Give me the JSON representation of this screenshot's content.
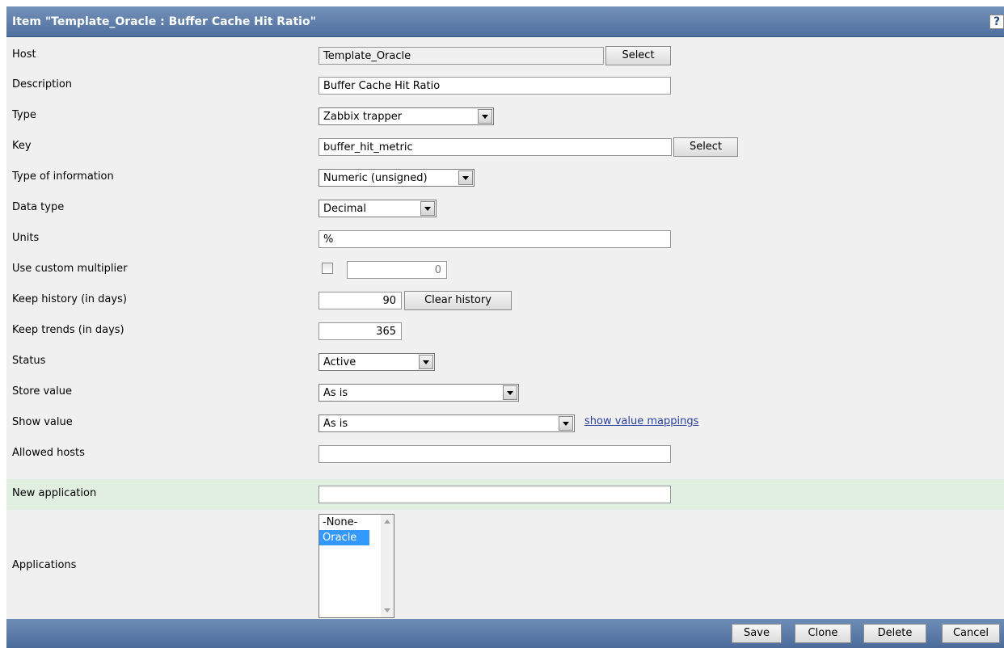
{
  "title": "Item \"Template_Oracle : Buffer Cache Hit Ratio\"",
  "help_label": "?",
  "fields": {
    "host": {
      "label": "Host",
      "value": "Template_Oracle",
      "button": "Select"
    },
    "description": {
      "label": "Description",
      "value": "Buffer Cache Hit Ratio"
    },
    "type": {
      "label": "Type",
      "value": "Zabbix trapper"
    },
    "key": {
      "label": "Key",
      "value": "buffer_hit_metric",
      "button": "Select"
    },
    "type_of_information": {
      "label": "Type of information",
      "value": "Numeric (unsigned)"
    },
    "data_type": {
      "label": "Data type",
      "value": "Decimal"
    },
    "units": {
      "label": "Units",
      "value": "%"
    },
    "custom_multiplier": {
      "label": "Use custom multiplier",
      "checked": false,
      "value": "0"
    },
    "keep_history": {
      "label": "Keep history (in days)",
      "value": "90",
      "button": "Clear history"
    },
    "keep_trends": {
      "label": "Keep trends (in days)",
      "value": "365"
    },
    "status": {
      "label": "Status",
      "value": "Active"
    },
    "store_value": {
      "label": "Store value",
      "value": "As is"
    },
    "show_value": {
      "label": "Show value",
      "value": "As is",
      "link": "show value mappings"
    },
    "allowed_hosts": {
      "label": "Allowed hosts",
      "value": ""
    },
    "new_application": {
      "label": "New application",
      "value": ""
    },
    "applications": {
      "label": "Applications",
      "options": [
        "-None-",
        "Oracle"
      ],
      "selected": "Oracle"
    }
  },
  "footer": {
    "save": "Save",
    "clone": "Clone",
    "delete": "Delete",
    "cancel": "Cancel"
  },
  "colors": {
    "header": "#5a79a6",
    "highlight_row": "#e1efe1",
    "selection": "#3399ff"
  }
}
